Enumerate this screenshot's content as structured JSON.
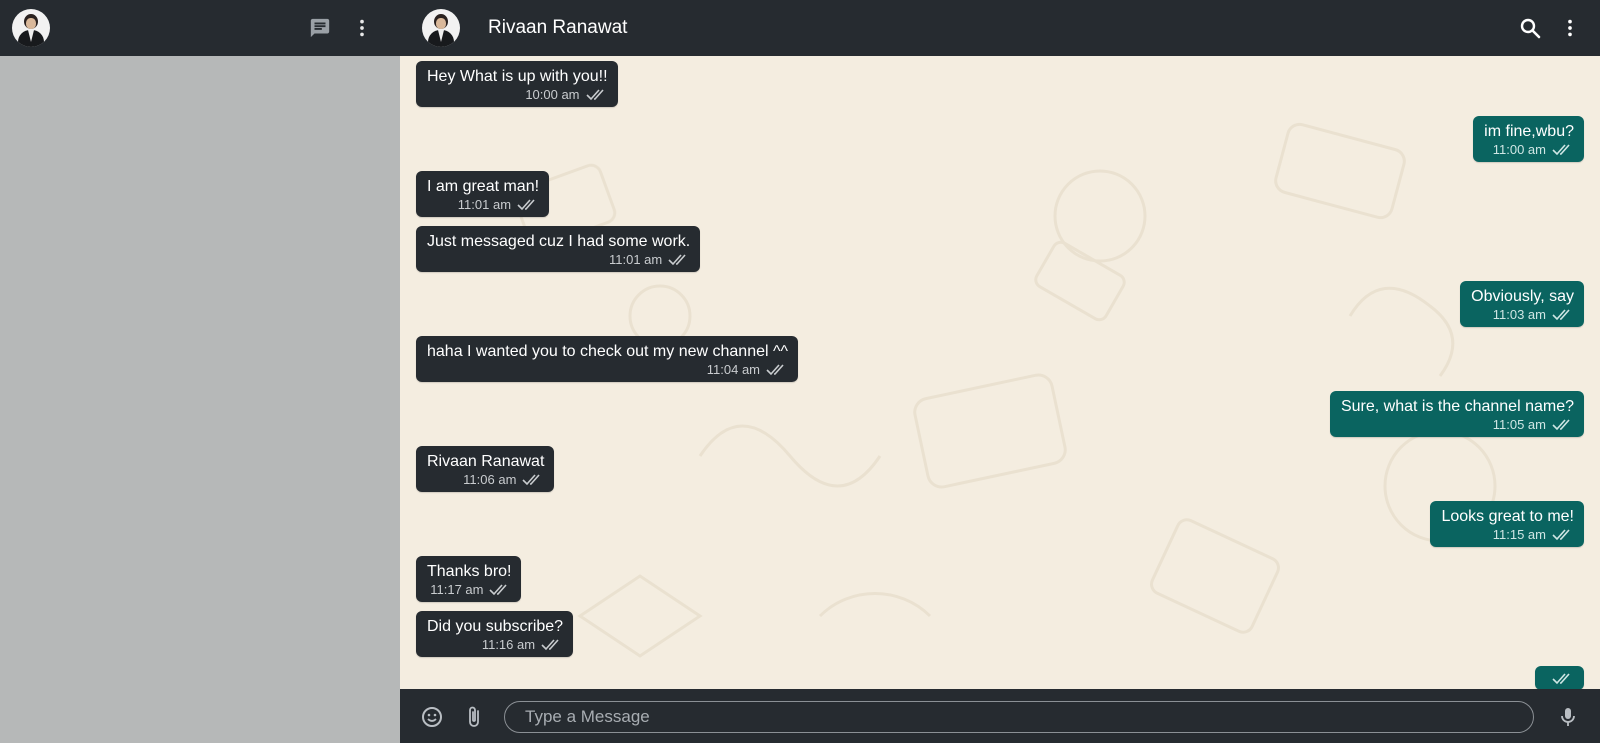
{
  "sidebar": {
    "new_chat_icon": "message-icon",
    "menu_icon": "more-vert-icon"
  },
  "chat": {
    "contact_name": "Rivaan Ranawat",
    "search_icon": "search-icon",
    "menu_icon": "more-vert-icon"
  },
  "messages": [
    {
      "side": "in",
      "text": "Hey What is up with you!!",
      "time": "10:00 am"
    },
    {
      "side": "out",
      "text": "im fine,wbu?",
      "time": "11:00 am"
    },
    {
      "side": "in",
      "text": "I am great man!",
      "time": "11:01 am"
    },
    {
      "side": "in",
      "text": "Just messaged cuz I had some work.",
      "time": "11:01 am"
    },
    {
      "side": "out",
      "text": "Obviously, say",
      "time": "11:03 am"
    },
    {
      "side": "in",
      "text": "haha I wanted you to check out my new channel ^^",
      "time": "11:04 am"
    },
    {
      "side": "out",
      "text": "Sure, what is the channel name?",
      "time": "11:05 am"
    },
    {
      "side": "in",
      "text": "Rivaan Ranawat",
      "time": "11:06 am"
    },
    {
      "side": "out",
      "text": "Looks great to me!",
      "time": "11:15 am"
    },
    {
      "side": "in",
      "text": "Thanks bro!",
      "time": "11:17 am"
    },
    {
      "side": "in",
      "text": "Did you subscribe?",
      "time": "11:16 am"
    },
    {
      "side": "out",
      "text": "",
      "time": ""
    }
  ],
  "composer": {
    "placeholder": "Type a Message"
  },
  "colors": {
    "header_bg": "#262b30",
    "incoming_bubble": "#262b30",
    "outgoing_bubble": "#0a6460",
    "chat_bg": "#f4ede0",
    "sidebar_bg": "#b6b8b8"
  }
}
